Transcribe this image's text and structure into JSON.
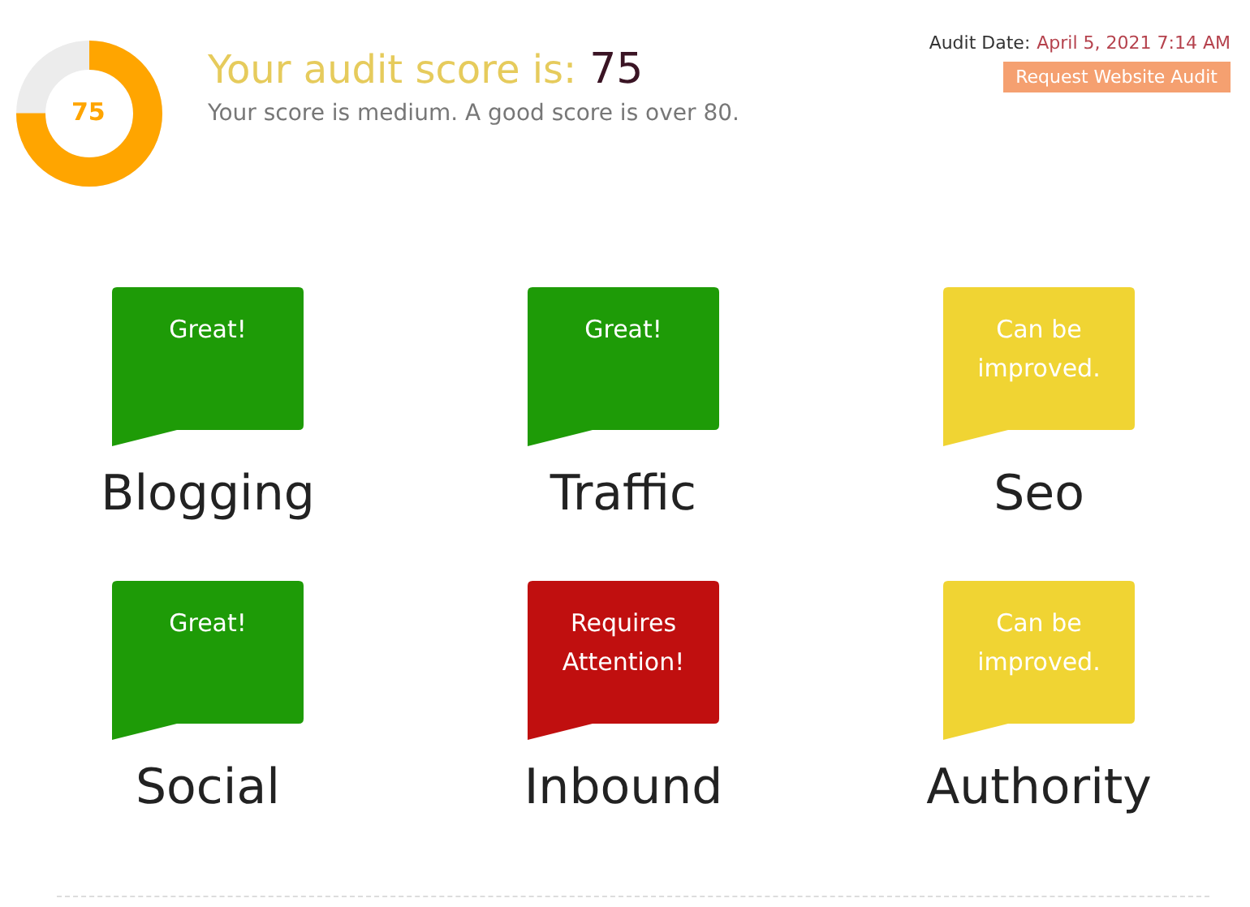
{
  "score": {
    "value": "75",
    "level": 0.75,
    "heading": "Your audit score is:",
    "heading_value": "75",
    "summary": "Your score is medium. A good score is over 80."
  },
  "audit": {
    "date_label": "Audit Date:",
    "date": "April 5, 2021 7:14 AM",
    "button": "Request Website Audit"
  },
  "categories": [
    {
      "name": "Blogging",
      "status": "Great!",
      "kind": "great"
    },
    {
      "name": "Traffic",
      "status": "Great!",
      "kind": "great"
    },
    {
      "name": "Seo",
      "status": "Can be improved.",
      "kind": "improve"
    },
    {
      "name": "Social",
      "status": "Great!",
      "kind": "great"
    },
    {
      "name": "Inbound",
      "status": "Requires Attention!",
      "kind": "attention"
    },
    {
      "name": "Authority",
      "status": "Can be improved.",
      "kind": "improve"
    }
  ]
}
